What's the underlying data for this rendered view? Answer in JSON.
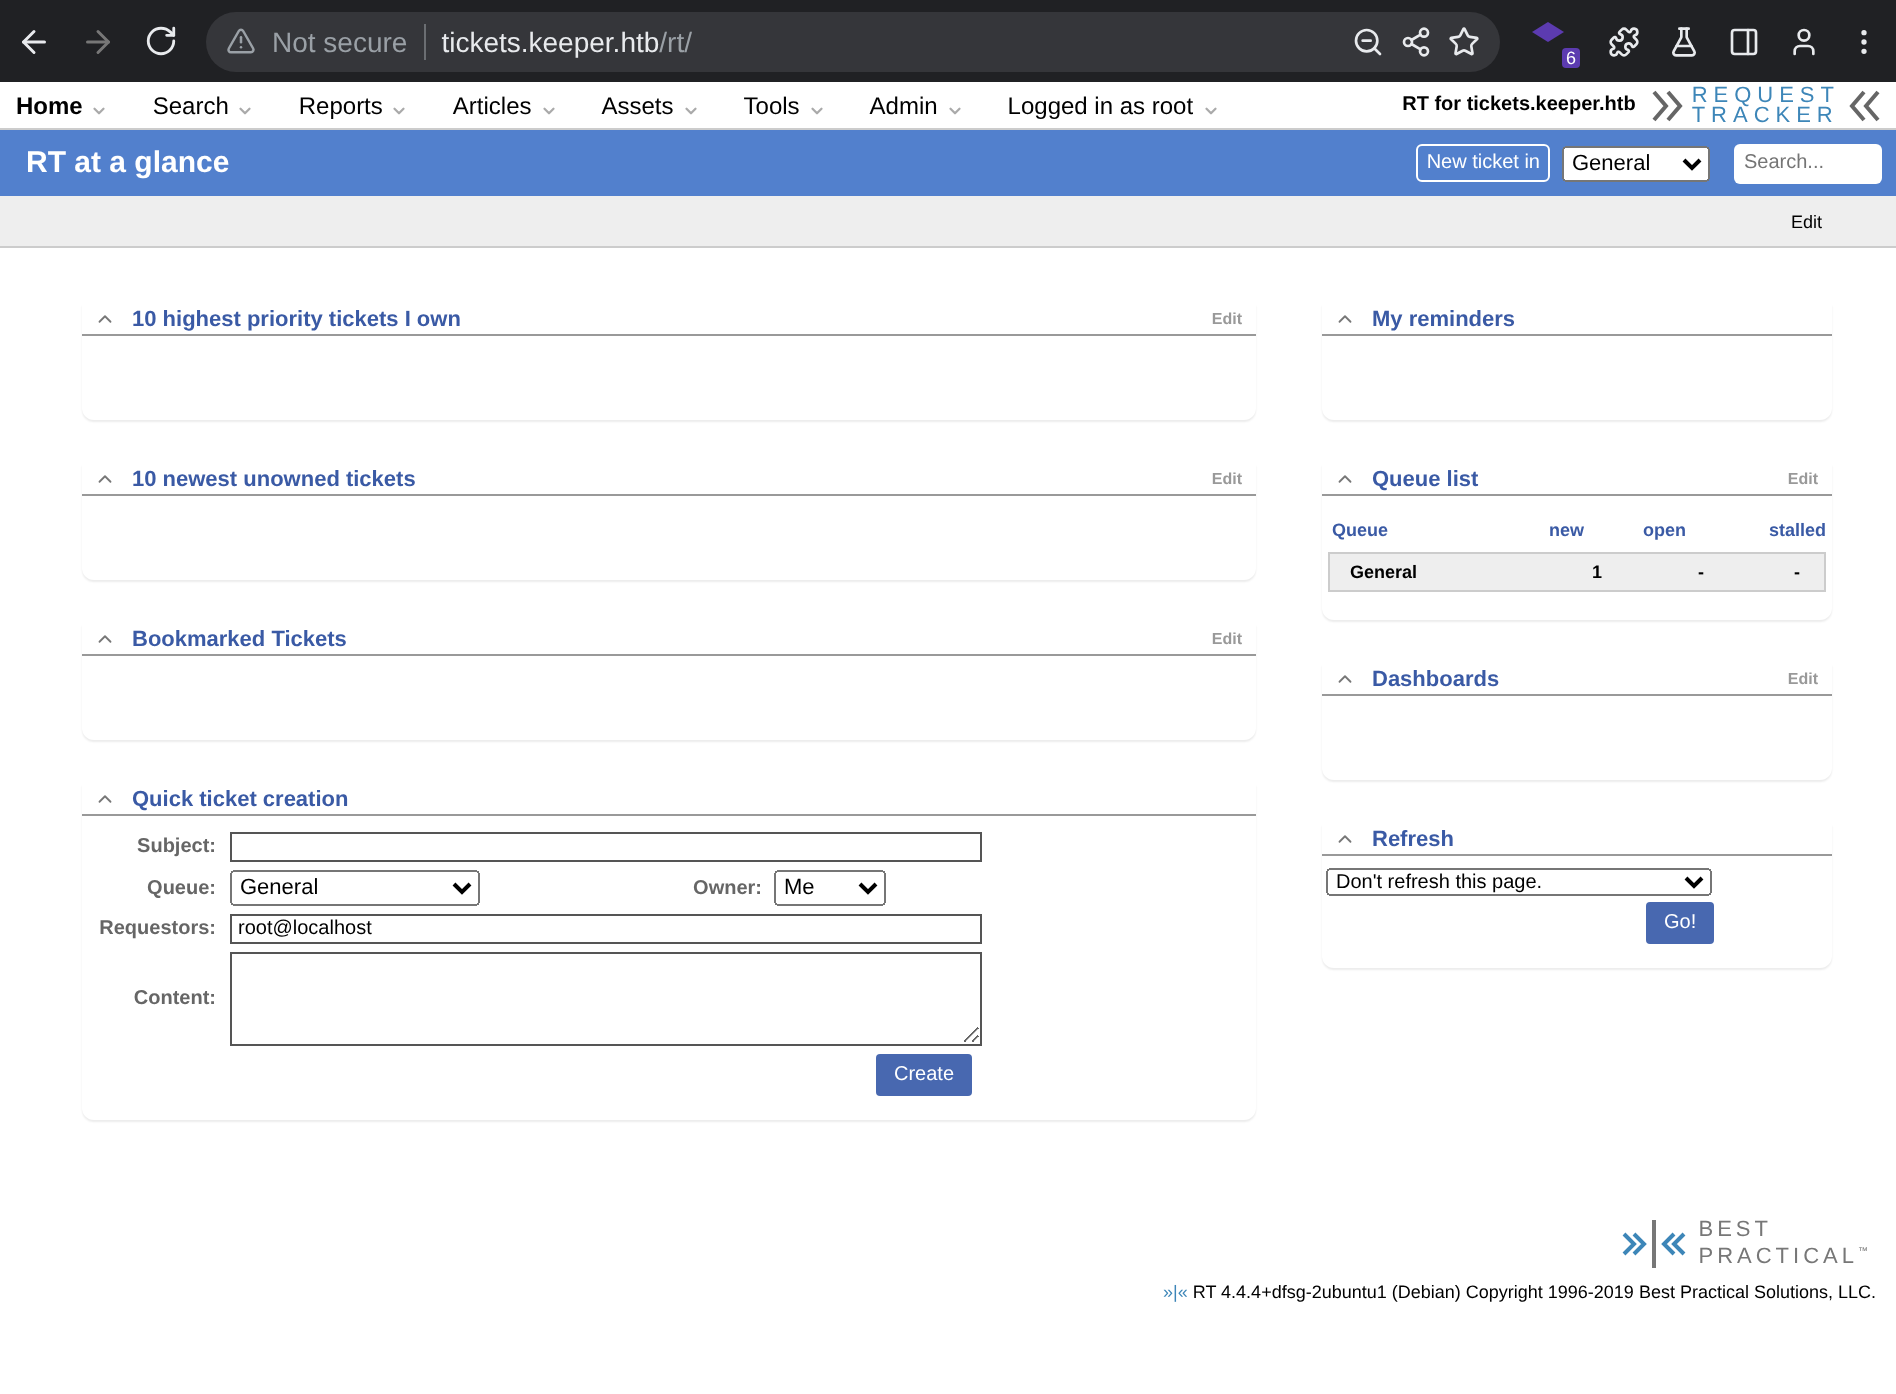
{
  "browser": {
    "security": "Not secure",
    "host": "tickets.keeper.htb",
    "path": "/rt/",
    "extension_badge": "6"
  },
  "menu": {
    "items": [
      {
        "label": "Home",
        "selected": true
      },
      {
        "label": "Search",
        "selected": false
      },
      {
        "label": "Reports",
        "selected": false
      },
      {
        "label": "Articles",
        "selected": false
      },
      {
        "label": "Assets",
        "selected": false
      },
      {
        "label": "Tools",
        "selected": false
      },
      {
        "label": "Admin",
        "selected": false
      },
      {
        "label": "Logged in as root",
        "selected": false
      }
    ],
    "brand": "RT for tickets.keeper.htb",
    "logo_top": "REQUEST",
    "logo_bottom": "TRACKER"
  },
  "header": {
    "title": "RT at a glance",
    "new_ticket_button": "New ticket in",
    "queue": "General",
    "search": {
      "placeholder": "Search..."
    }
  },
  "subbar": {
    "edit": "Edit"
  },
  "left_portlets": [
    {
      "kind": "empty",
      "title": "10 highest priority tickets I own",
      "edit": "Edit"
    },
    {
      "kind": "empty",
      "title": "10 newest unowned tickets",
      "edit": "Edit"
    },
    {
      "kind": "empty",
      "title": "Bookmarked Tickets",
      "edit": "Edit"
    },
    {
      "kind": "form",
      "title": "Quick ticket creation",
      "form": {
        "subject_label": "Subject:",
        "queue_label": "Queue:",
        "queue": "General",
        "owner_label": "Owner:",
        "owner": "Me",
        "requestors_label": "Requestors:",
        "requestors": "root@localhost",
        "content_label": "Content:",
        "create_button": "Create"
      }
    }
  ],
  "right_portlets": [
    {
      "kind": "empty",
      "title": "My reminders"
    },
    {
      "kind": "table",
      "title": "Queue list",
      "edit": "Edit",
      "table": {
        "columns": [
          "Queue",
          "new",
          "open",
          "stalled"
        ],
        "rows": [
          [
            "General",
            "1",
            "-",
            "-"
          ]
        ]
      }
    },
    {
      "kind": "empty",
      "title": "Dashboards",
      "edit": "Edit"
    },
    {
      "kind": "refresh",
      "title": "Refresh",
      "refresh": {
        "option": "Don't refresh this page.",
        "button": "Go!"
      }
    }
  ],
  "footer": {
    "logo_top": "BEST",
    "logo_bottom": "PRACTICAL",
    "tm": "™",
    "mark": "»|«",
    "copyright": "RT 4.4.4+dfsg-2ubuntu1 (Debian) Copyright 1996-2019 Best Practical Solutions, LLC."
  }
}
